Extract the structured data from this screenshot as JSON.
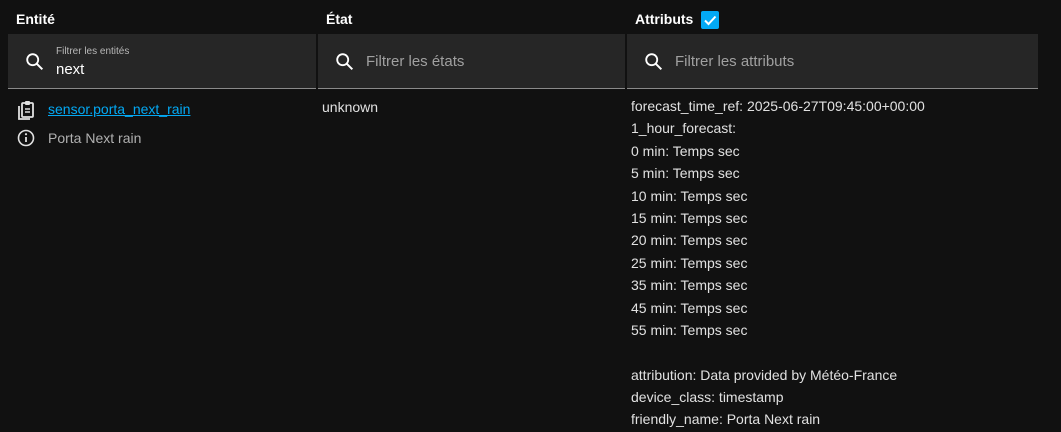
{
  "headers": {
    "entity": "Entité",
    "state": "État",
    "attributes": "Attributs"
  },
  "filters": {
    "entity": {
      "label": "Filtrer les entités",
      "value": "next"
    },
    "state": {
      "placeholder": "Filtrer les états"
    },
    "attributes": {
      "placeholder": "Filtrer les attributs"
    }
  },
  "attributes_checkbox": {
    "checked": true
  },
  "row": {
    "entity_id": "sensor.porta_next_rain",
    "friendly_name": "Porta Next rain",
    "state": "unknown",
    "attributes": [
      "forecast_time_ref: 2025-06-27T09:45:00+00:00",
      "1_hour_forecast:",
      "0 min: Temps sec",
      "5 min: Temps sec",
      "10 min: Temps sec",
      "15 min: Temps sec",
      "20 min: Temps sec",
      "25 min: Temps sec",
      "35 min: Temps sec",
      "45 min: Temps sec",
      "55 min: Temps sec",
      "",
      "attribution: Data provided by Météo-France",
      "device_class: timestamp",
      "friendly_name: Porta Next rain"
    ]
  },
  "icons": {
    "search": "search-icon",
    "copy": "clipboard-icon",
    "info": "info-icon",
    "check": "check-icon"
  },
  "colors": {
    "background": "#111111",
    "filter_bg": "#262626",
    "accent": "#03a9f4",
    "text": "#e1e1e1"
  }
}
